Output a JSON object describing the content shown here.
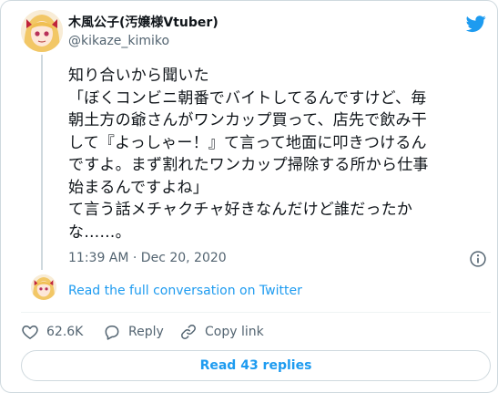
{
  "author": {
    "display_name": "木風公子(汚嬢様Vtuber)",
    "handle": "@kikaze_kimiko"
  },
  "icons": {
    "brand": "twitter-bird-icon",
    "info": "info-icon",
    "like": "heart-icon",
    "reply": "reply-bubble-icon",
    "copy": "link-icon"
  },
  "colors": {
    "accent": "#1d9bf0",
    "text": "#0f1419",
    "muted": "#536471",
    "border": "#cfd9de"
  },
  "tweet": {
    "text": "知り合いから聞いた\n「ぼくコンビニ朝番でバイトしてるんですけど、毎\n朝土方の爺さんがワンカップ買って、店先で飲み干\nして『よっしゃー！』て言って地面に叩きつけるん\nですよ。まず割れたワンカップ掃除する所から仕事\n始まるんですよね」\nて言う話メチャクチャ好きなんだけど誰だったか\nな……。",
    "timestamp": "11:39 AM · Dec 20, 2020"
  },
  "conversation": {
    "read_full_label": "Read the full conversation on Twitter"
  },
  "actions": {
    "like_count": "62.6K",
    "reply_label": "Reply",
    "copy_link_label": "Copy link"
  },
  "footer": {
    "read_replies_label": "Read 43 replies"
  }
}
